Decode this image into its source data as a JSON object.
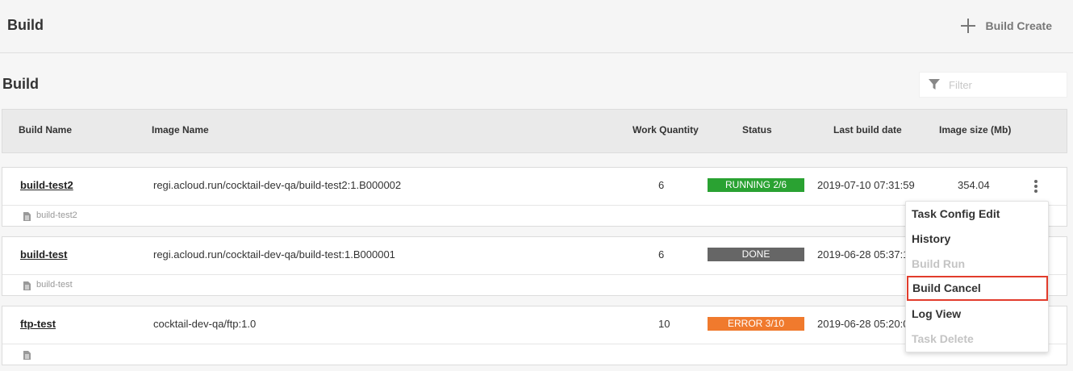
{
  "header": {
    "title": "Build",
    "create_label": "Build Create"
  },
  "section": {
    "title": "Build"
  },
  "filter": {
    "placeholder": "Filter"
  },
  "table": {
    "columns": {
      "build_name": "Build Name",
      "image_name": "Image Name",
      "work_quantity": "Work Quantity",
      "status": "Status",
      "last_build_date": "Last build date",
      "image_size": "Image size (Mb)"
    },
    "rows": [
      {
        "name": "build-test2",
        "image": "regi.acloud.run/cocktail-dev-qa/build-test2:1.B000002",
        "qty": "6",
        "status": "RUNNING 2/6",
        "status_color": "#2aa232",
        "date": "2019-07-10 07:31:59",
        "size": "354.04",
        "sub": "build-test2"
      },
      {
        "name": "build-test",
        "image": "regi.acloud.run/cocktail-dev-qa/build-test:1.B000001",
        "qty": "6",
        "status": "DONE",
        "status_color": "#666666",
        "date": "2019-06-28 05:37:1",
        "size": "",
        "sub": "build-test"
      },
      {
        "name": "ftp-test",
        "image": "cocktail-dev-qa/ftp:1.0",
        "qty": "10",
        "status": "ERROR 3/10",
        "status_color": "#f07a2d",
        "date": "2019-06-28 05:20:0",
        "size": "",
        "sub": ""
      }
    ]
  },
  "context_menu": {
    "items": [
      {
        "label": "Task Config Edit",
        "disabled": false
      },
      {
        "label": "History",
        "disabled": false
      },
      {
        "label": "Build Run",
        "disabled": true
      },
      {
        "label": "Build Cancel",
        "disabled": false,
        "highlighted": true
      },
      {
        "label": "Log View",
        "disabled": false
      },
      {
        "label": "Task Delete",
        "disabled": true
      }
    ]
  },
  "icons": {
    "create": "plus-icon",
    "filter": "filter-icon",
    "row_menu": "kebab-menu-icon",
    "doc": "document-icon"
  },
  "colors": {
    "highlight_border": "#e23c2c",
    "running": "#2aa232",
    "done": "#666666",
    "error": "#f07a2d"
  }
}
